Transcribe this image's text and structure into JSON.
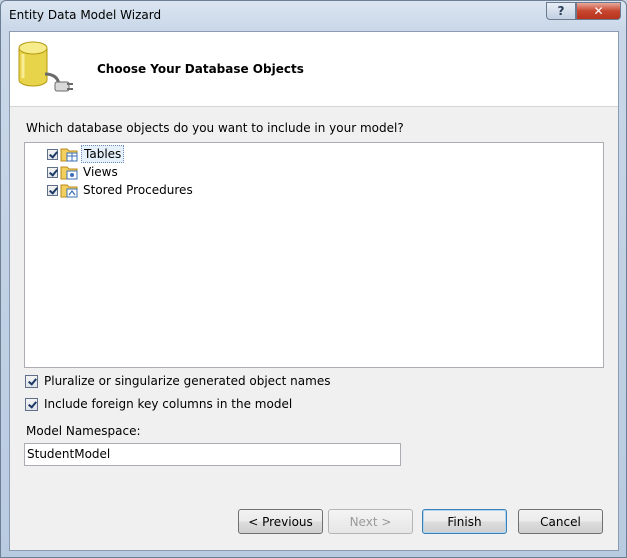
{
  "window": {
    "title": "Entity Data Model Wizard",
    "help_label": "?",
    "close_label": "✕"
  },
  "header": {
    "title": "Choose Your Database Objects"
  },
  "main": {
    "question": "Which database objects do you want to include in your model?",
    "tree": [
      {
        "label": "Tables",
        "checked": true,
        "selected": true
      },
      {
        "label": "Views",
        "checked": true,
        "selected": false
      },
      {
        "label": "Stored Procedures",
        "checked": true,
        "selected": false
      }
    ],
    "options": {
      "pluralize": {
        "label": "Pluralize or singularize generated object names",
        "checked": true
      },
      "foreign_keys": {
        "label": "Include foreign key columns in the model",
        "checked": true
      }
    },
    "namespace": {
      "label": "Model Namespace:",
      "value": "StudentModel"
    }
  },
  "buttons": {
    "previous": "< Previous",
    "next": "Next >",
    "finish": "Finish",
    "cancel": "Cancel"
  },
  "colors": {
    "accent": "#3c7fb1",
    "header_bg": "#ffffff",
    "client_bg": "#f0f0f0"
  }
}
